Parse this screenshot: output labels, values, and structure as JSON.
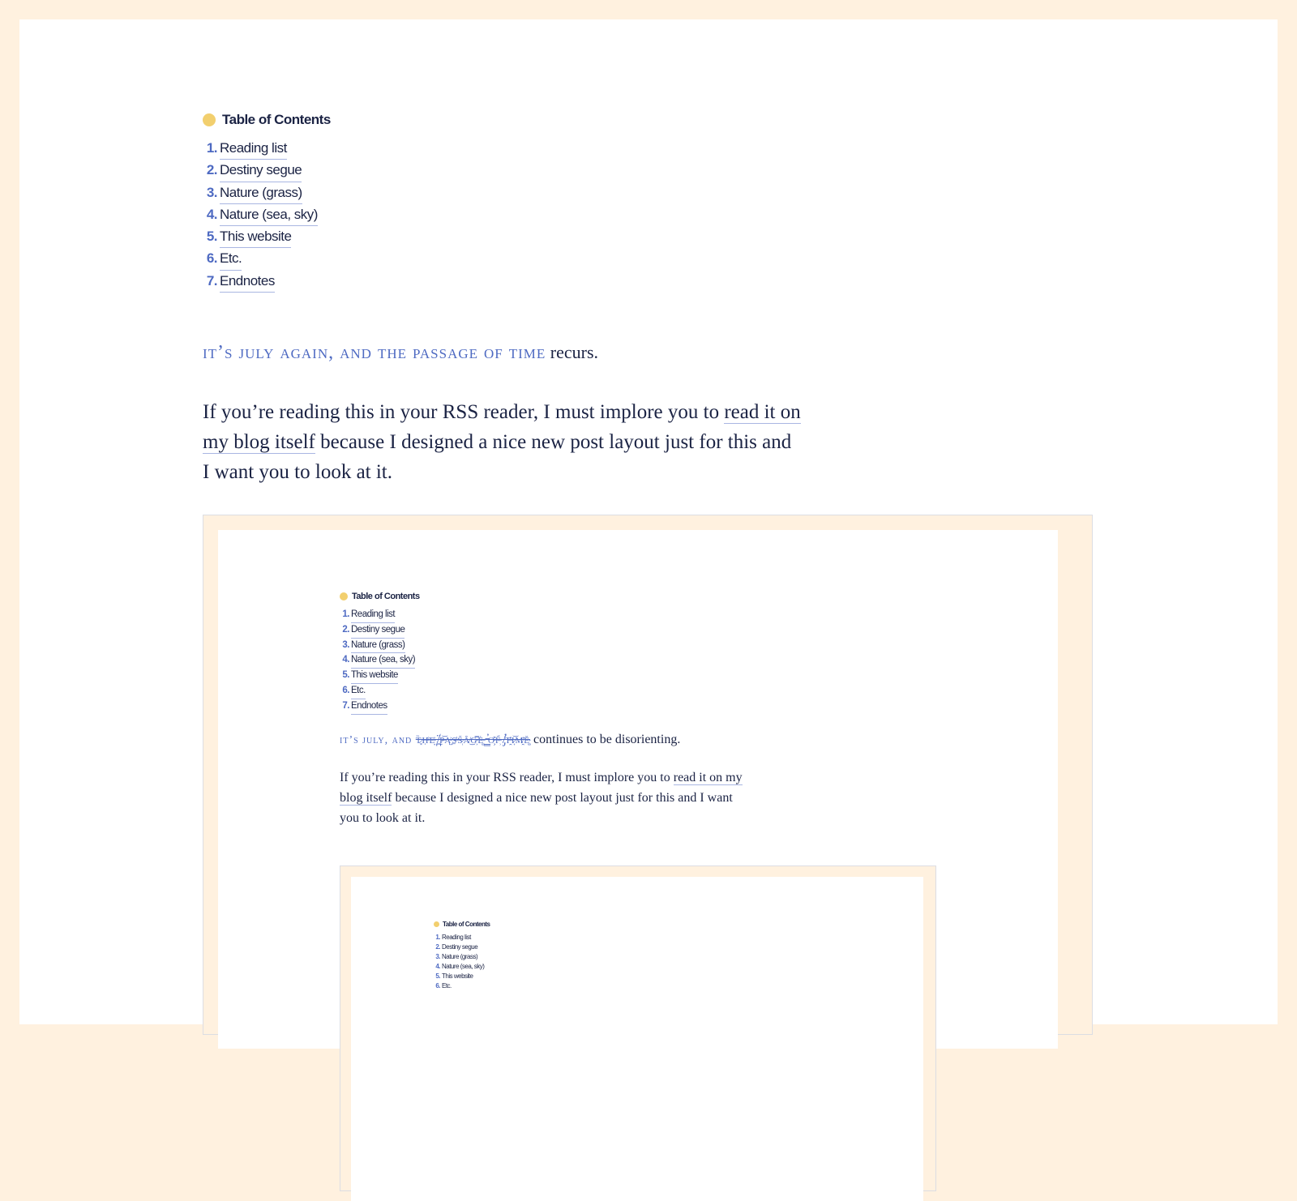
{
  "colors": {
    "background": "#fff1df",
    "page": "#ffffff",
    "text": "#1b2344",
    "accent": "#4e6ac2",
    "toc_dot": "#f2cf6e",
    "link_underline": "#a9b6e2"
  },
  "toc": {
    "title": "Table of Contents",
    "items": [
      {
        "num": "1.",
        "label": "Reading list"
      },
      {
        "num": "2.",
        "label": "Destiny segue"
      },
      {
        "num": "3.",
        "label": "Nature (grass)"
      },
      {
        "num": "4.",
        "label": "Nature (sea, sky)"
      },
      {
        "num": "5.",
        "label": "This website"
      },
      {
        "num": "6.",
        "label": "Etc."
      },
      {
        "num": "7.",
        "label": "Endnotes"
      }
    ]
  },
  "post": {
    "lede_smallcaps": "It’s July again, and the passage of time",
    "lede_rest": " recurs.",
    "para_before": "If you’re reading this in your RSS reader, I must implore you to ",
    "para_link": "read it on my blog itself",
    "para_after": " because I designed a nice new post layout just for this and I want you to look at it."
  },
  "embedded_screenshot": {
    "lede_smallcaps": "It’s July, and ",
    "lede_glitch": "t̷͓̏ḥ̵̊e̴̟̓ ̸̪̈p̶̰͝a̵̺͐s̶̱̾s̷̜̃ȃ̸͜g̵͕̿ė̶͚ ̵̳̕o̴̧͒f̵̹̈́ ̸̡̛t̶̯̽i̷͎͝m̸̯̓ě̴͚",
    "lede_rest": " continues to be disorienting.",
    "para_before": "If you’re reading this in your RSS reader, I must implore you to ",
    "para_link": "read it on my blog itself",
    "para_after": " because I designed a nice new post layout just for this and I want you to look at it."
  }
}
